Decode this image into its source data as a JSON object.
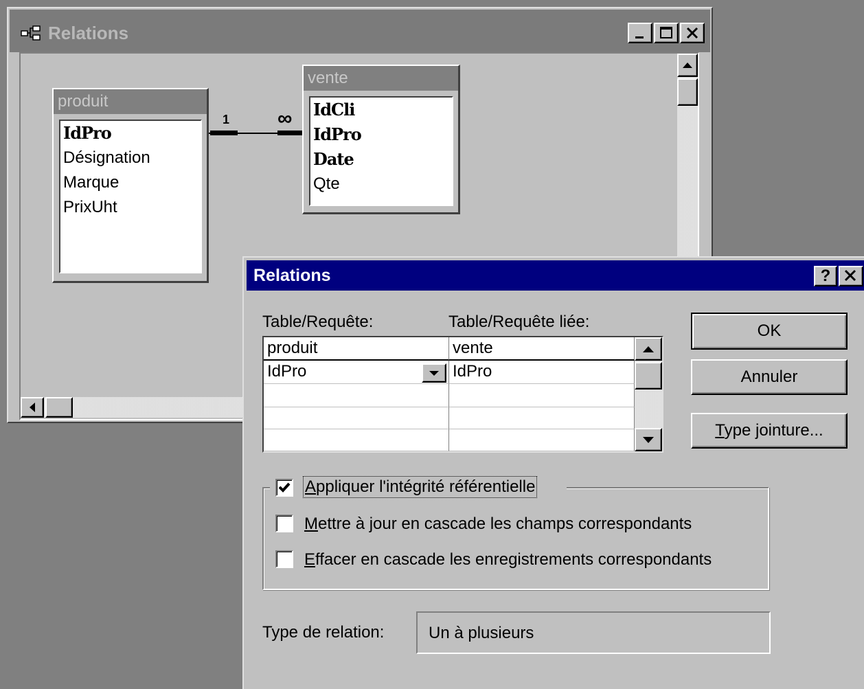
{
  "relations_window": {
    "title": "Relations",
    "tables": [
      {
        "name": "produit",
        "fields": [
          {
            "name": "IdPro",
            "key": true
          },
          {
            "name": "Désignation",
            "key": false
          },
          {
            "name": "Marque",
            "key": false
          },
          {
            "name": "PrixUht",
            "key": false
          }
        ]
      },
      {
        "name": "vente",
        "fields": [
          {
            "name": "IdCli",
            "key": true
          },
          {
            "name": "IdPro",
            "key": true
          },
          {
            "name": "Date",
            "key": true
          },
          {
            "name": "Qte",
            "key": false
          }
        ]
      }
    ],
    "relationship": {
      "one_label": "1",
      "many_label": "∞"
    }
  },
  "dialog": {
    "title": "Relations",
    "help_button": "?",
    "close_button": "✕",
    "table_label": "Table/Requête:",
    "related_label": "Table/Requête liée:",
    "grid": {
      "headers": [
        "produit",
        "vente"
      ],
      "rows": [
        [
          "IdPro",
          "IdPro"
        ],
        [
          "",
          ""
        ],
        [
          "",
          ""
        ],
        [
          "",
          ""
        ]
      ]
    },
    "buttons": {
      "ok": "OK",
      "cancel": "Annuler",
      "join_type_prefix": "T",
      "join_type_rest": "ype jointure..."
    },
    "integrity": {
      "checked": true,
      "accel": "A",
      "label_rest": "ppliquer l'intégrité référentielle"
    },
    "cascade_update": {
      "checked": false,
      "accel": "M",
      "label_rest": "ettre à jour en cascade les champs correspondants"
    },
    "cascade_delete": {
      "checked": false,
      "accel": "E",
      "label_rest": "ffacer en cascade les enregistrements correspondants"
    },
    "relation_type_label": "Type de relation:",
    "relation_type_value": "Un à plusieurs"
  }
}
